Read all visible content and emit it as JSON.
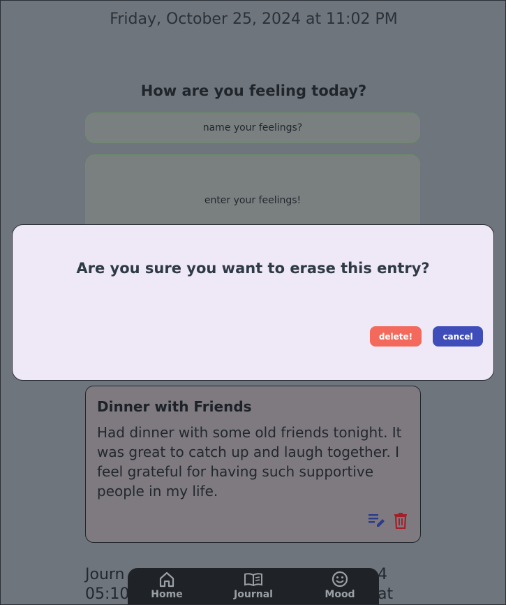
{
  "header": {
    "datetime": "Friday, October 25, 2024 at 11:02 PM"
  },
  "form": {
    "prompt": "How are you feeling today?",
    "name_placeholder": "name your feelings?",
    "feelings_placeholder": "enter your feelings!"
  },
  "modal": {
    "question": "Are you sure you want to erase this entry?",
    "delete_label": "delete!",
    "cancel_label": "cancel"
  },
  "entry": {
    "title": "Dinner with Friends",
    "body": "Had dinner with some old friends tonight. It was great to catch up and laugh together. I feel grateful for having such supportive people in my life.",
    "edit_icon": "edit-note-icon",
    "delete_icon": "trash-icon"
  },
  "next_entry": {
    "text_line1": "Journ",
    "text_line1_end": "4 at",
    "text_line2": "05:10"
  },
  "nav": {
    "items": [
      {
        "label": "Home",
        "icon": "home-icon"
      },
      {
        "label": "Journal",
        "icon": "book-icon"
      },
      {
        "label": "Mood",
        "icon": "smiley-icon"
      }
    ]
  },
  "colors": {
    "overlay_bg": "#6f757c",
    "modal_bg": "#efe8f6",
    "delete": "#f36a5c",
    "cancel": "#3f4dbb",
    "nav_bg": "#1f2327",
    "icon_edit": "#2c3a8c",
    "icon_trash": "#a3202a"
  }
}
